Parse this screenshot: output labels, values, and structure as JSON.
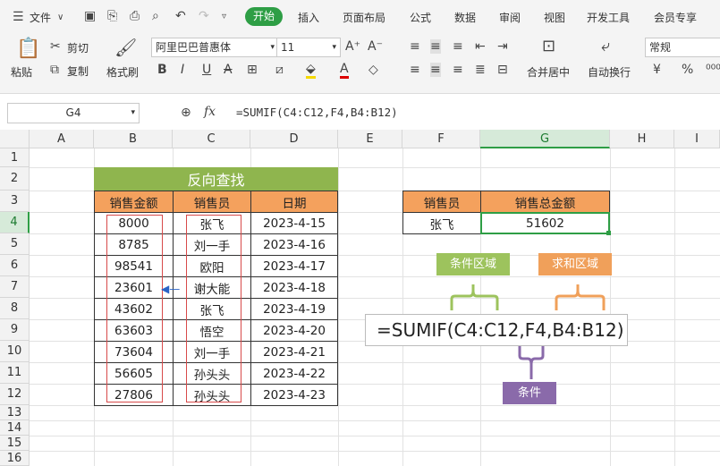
{
  "menu": {
    "file": "文件",
    "tabs": [
      "开始",
      "插入",
      "页面布局",
      "公式",
      "数据",
      "审阅",
      "视图",
      "开发工具",
      "会员专享"
    ],
    "active_tab": "开始"
  },
  "ribbon": {
    "paste": "粘贴",
    "cut": "剪切",
    "copy": "复制",
    "format_painter": "格式刷",
    "font_name": "阿里巴巴普惠体",
    "font_size": "11",
    "merge_center": "合并居中",
    "wrap_text": "自动换行",
    "number_format": "常规",
    "percent_sym": "%",
    "currency_sym": "¥"
  },
  "formula_bar": {
    "name_box": "G4",
    "fx": "fx",
    "formula": "=SUMIF(C4:C12,F4,B4:B12)"
  },
  "columns": [
    "A",
    "B",
    "C",
    "D",
    "E",
    "F",
    "G",
    "H",
    "I"
  ],
  "rows": [
    "1",
    "2",
    "3",
    "4",
    "5",
    "6",
    "7",
    "8",
    "9",
    "10",
    "11",
    "12",
    "13",
    "14",
    "15",
    "16"
  ],
  "table": {
    "title": "反向查找",
    "headers": [
      "销售金额",
      "销售员",
      "日期"
    ],
    "rows": [
      [
        "8000",
        "张飞",
        "2023-4-15"
      ],
      [
        "8785",
        "刘一手",
        "2023-4-16"
      ],
      [
        "98541",
        "欧阳",
        "2023-4-17"
      ],
      [
        "23601",
        "谢大能",
        "2023-4-18"
      ],
      [
        "43602",
        "张飞",
        "2023-4-19"
      ],
      [
        "63603",
        "悟空",
        "2023-4-20"
      ],
      [
        "73604",
        "刘一手",
        "2023-4-21"
      ],
      [
        "56605",
        "孙头头",
        "2023-4-22"
      ],
      [
        "27806",
        "孙头头",
        "2023-4-23"
      ]
    ]
  },
  "lookup": {
    "headers": [
      "销售员",
      "销售总金额"
    ],
    "name": "张飞",
    "total": "51602"
  },
  "annotations": {
    "condition_range": "条件区域",
    "sum_range": "求和区域",
    "condition": "条件",
    "formula": "=SUMIF(C4:C12,F4,B4:B12)"
  },
  "colors": {
    "accent_green": "#2e9e45",
    "title_green": "#8fb54e",
    "header_orange": "#f4a15d",
    "condition_box": "#9dc35d",
    "sum_box": "#f0a05a",
    "purple": "#8a6aaa"
  }
}
